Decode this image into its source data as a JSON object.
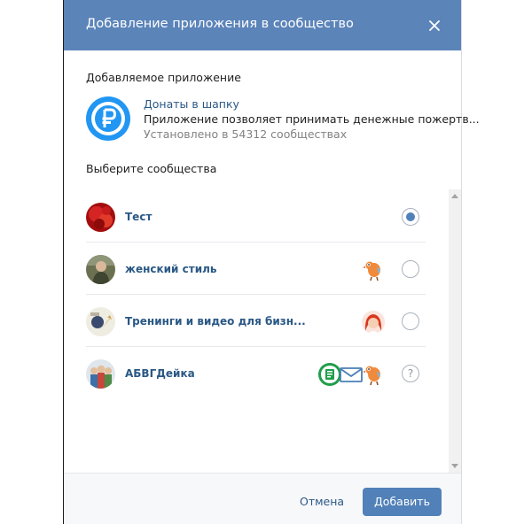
{
  "header": {
    "title": "Добавление приложения в сообщество"
  },
  "app_section": {
    "label": "Добавляемое приложение",
    "app": {
      "name": "Донаты в шапку",
      "description": "Приложение позволяет принимать денежные пожертв...",
      "installed": "Установлено в 54312 сообществах",
      "icon": "ruble-icon",
      "icon_color": "#2196f3"
    }
  },
  "communities_section": {
    "label": "Выберите сообщества",
    "items": [
      {
        "name": "Тест",
        "state": "selected",
        "badges": []
      },
      {
        "name": "женский стиль",
        "state": "unselected",
        "badges": [
          "bird-app-icon"
        ]
      },
      {
        "name": "Тренинги и видео для бизн...",
        "state": "unselected",
        "badges": [
          "girl-avatar-app-icon"
        ]
      },
      {
        "name": "АБВГДейка",
        "state": "unknown",
        "question_mark": "?",
        "badges": [
          "green-app-icon",
          "envelope-icon",
          "bird-app-icon"
        ]
      }
    ]
  },
  "footer": {
    "cancel_label": "Отмена",
    "add_label": "Добавить"
  },
  "colors": {
    "header": "#5b84b9",
    "accent": "#5181b8",
    "link": "#2a5885"
  }
}
